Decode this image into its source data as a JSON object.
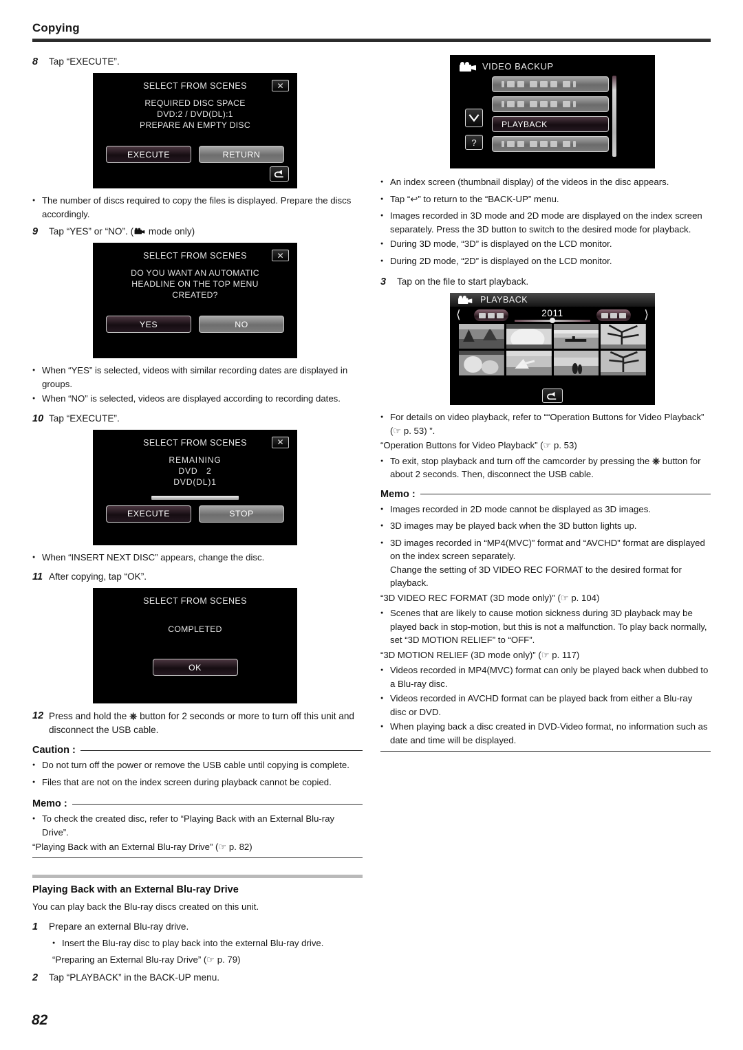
{
  "header": {
    "title": "Copying"
  },
  "page_number": "82",
  "left_column": {
    "step8": {
      "num": "8",
      "text": "Tap “EXECUTE”.",
      "screen": {
        "title": "SELECT FROM SCENES",
        "close": "✕",
        "body_lines": [
          "REQUIRED DISC SPACE",
          "DVD:2 / DVD(DL):1",
          "PREPARE AN EMPTY DISC"
        ],
        "btn_primary": "EXECUTE",
        "btn_secondary": "RETURN"
      },
      "bullets": [
        "The number of discs required to copy the files is displayed. Prepare the discs accordingly."
      ]
    },
    "step9": {
      "num": "9",
      "text_before": "Tap “YES” or “NO”. (",
      "text_after": " mode only)",
      "screen": {
        "title": "SELECT FROM SCENES",
        "close": "✕",
        "body_lines": [
          "DO YOU WANT AN AUTOMATIC",
          "HEADLINE ON THE TOP MENU",
          "CREATED?"
        ],
        "btn_primary": "YES",
        "btn_secondary": "NO"
      },
      "bullets": [
        "When “YES” is selected, videos with similar recording dates are displayed in groups.",
        "When “NO” is selected, videos are displayed according to recording dates."
      ]
    },
    "step10": {
      "num": "10",
      "text": "Tap “EXECUTE”.",
      "screen": {
        "title": "SELECT FROM SCENES",
        "close": "✕",
        "body_lines": [
          "REMAINING",
          "DVD   2",
          "DVD(DL)1"
        ],
        "progress_percent": 78,
        "btn_primary": "EXECUTE",
        "btn_secondary": "STOP"
      },
      "bullets": [
        "When “INSERT NEXT DISC” appears, change the disc."
      ]
    },
    "step11": {
      "num": "11",
      "text": "After copying, tap “OK”.",
      "screen": {
        "title": "SELECT FROM SCENES",
        "body_lines": [
          "COMPLETED"
        ],
        "btn_primary": "OK"
      }
    },
    "step12": {
      "num": "12",
      "text_before": "Press and hold the ",
      "text_after": " button for 2 seconds or more to turn off this unit and disconnect the USB cable."
    },
    "caution": {
      "label": "Caution :",
      "bullets": [
        "Do not turn off the power or remove the USB cable until copying is complete.",
        "Files that are not on the index screen during playback cannot be copied."
      ]
    },
    "memo": {
      "label": "Memo :",
      "bullets": [
        "To check the created disc, refer to “Playing Back with an External Blu-ray Drive”."
      ],
      "ref": "“Playing Back with an External Blu-ray Drive” (☞ p. 82)"
    },
    "section": {
      "heading": "Playing Back with an External Blu-ray Drive",
      "lead": "You can play back the Blu-ray discs created on this unit.",
      "step1": {
        "num": "1",
        "text": "Prepare an external Blu-ray drive.",
        "bullets": [
          "Insert the Blu-ray disc to play back into the external Blu-ray drive."
        ],
        "ref": "“Preparing an External Blu-ray Drive” (☞ p. 79)"
      },
      "step2": {
        "num": "2",
        "text": "Tap “PLAYBACK” in the BACK-UP menu."
      }
    }
  },
  "right_column": {
    "backup_screen": {
      "title": "VIDEO BACKUP",
      "items": [
        {
          "label": "",
          "redacted": true,
          "selected": false
        },
        {
          "label": "",
          "redacted": true,
          "selected": false
        },
        {
          "label": "PLAYBACK",
          "redacted": false,
          "selected": true
        },
        {
          "label": "",
          "redacted": true,
          "selected": false
        }
      ],
      "down_icon": "chevron-down",
      "help_label": "?"
    },
    "after_backup_bullets": [
      "An index screen (thumbnail display) of the videos in the disc appears.",
      "Tap “↩” to return to the “BACK-UP” menu.",
      "Images recorded in 3D mode and 2D mode are displayed on the index screen separately. Press the 3D button to switch to the desired mode for playback.",
      "During 3D mode, “3D” is displayed on the LCD monitor.",
      "During 2D mode, “2D” is displayed on the LCD monitor."
    ],
    "step3": {
      "num": "3",
      "text": "Tap on the file to start playback.",
      "screen": {
        "title": "PLAYBACK",
        "year": "2011"
      }
    },
    "after_playback": {
      "bullets": [
        "For details on video playback, refer to ““Operation Buttons for Video Playback” (☞ p. 53) ”."
      ],
      "ref": "“Operation Buttons for Video Playback” (☞ p. 53)",
      "bullet_power_before": "To exit, stop playback and turn off the camcorder by pressing the ",
      "bullet_power_after": " button for about 2 seconds. Then, disconnect the USB cable."
    },
    "memo": {
      "label": "Memo :",
      "items": [
        {
          "type": "bullet",
          "text": "Images recorded in 2D mode cannot be displayed as 3D images."
        },
        {
          "type": "bullet",
          "text": "3D images may be played back when the 3D button lights up."
        },
        {
          "type": "bullet",
          "text": "3D images recorded in “MP4(MVC)” format and “AVCHD” format are displayed on the index screen separately.\nChange the setting of 3D VIDEO REC FORMAT to the desired format for playback."
        },
        {
          "type": "ref",
          "text": "“3D VIDEO REC FORMAT (3D mode only)” (☞ p. 104)"
        },
        {
          "type": "bullet",
          "text": "Scenes that are likely to cause motion sickness during 3D playback may be played back in stop-motion, but this is not a malfunction. To play back normally, set “3D MOTION RELIEF” to “OFF”."
        },
        {
          "type": "ref",
          "text": "“3D MOTION RELIEF (3D mode only)” (☞ p. 117)"
        },
        {
          "type": "bullet",
          "text": "Videos recorded in MP4(MVC) format can only be played back when dubbed to a Blu-ray disc."
        },
        {
          "type": "bullet",
          "text": "Videos recorded in AVCHD format can be played back from either a Blu-ray disc or DVD."
        },
        {
          "type": "bullet",
          "text": "When playing back a disc created in DVD-Video format, no information such as date and time will be displayed."
        }
      ]
    }
  }
}
